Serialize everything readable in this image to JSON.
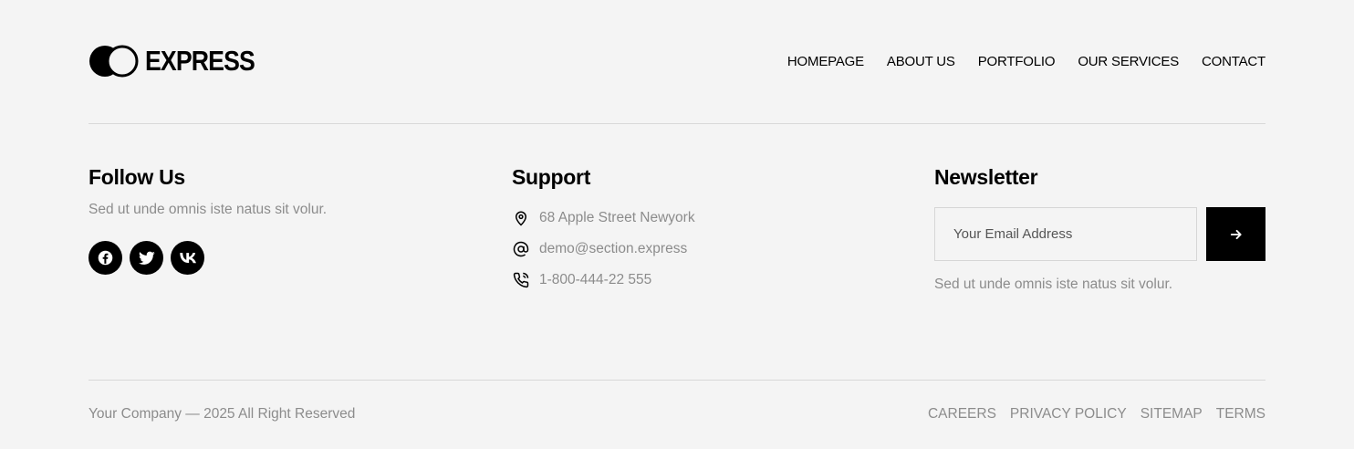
{
  "brand": {
    "name": "EXPRESS"
  },
  "nav": [
    {
      "label": "HOMEPAGE"
    },
    {
      "label": "ABOUT US"
    },
    {
      "label": "PORTFOLIO"
    },
    {
      "label": "OUR SERVICES"
    },
    {
      "label": "CONTACT"
    }
  ],
  "follow": {
    "title": "Follow Us",
    "description": "Sed ut unde omnis iste natus sit volur.",
    "social": [
      {
        "icon": "facebook-icon"
      },
      {
        "icon": "twitter-icon"
      },
      {
        "icon": "vk-icon"
      }
    ]
  },
  "support": {
    "title": "Support",
    "items": [
      {
        "icon": "location-pin-icon",
        "text": "68 Apple Street Newyork"
      },
      {
        "icon": "at-sign-icon",
        "text": "demo@section.express"
      },
      {
        "icon": "phone-icon",
        "text": "1-800-444-22 555"
      }
    ]
  },
  "newsletter": {
    "title": "Newsletter",
    "placeholder": "Your Email Address",
    "value": "",
    "submit_icon": "arrow-right-icon",
    "description": "Sed ut unde omnis iste natus sit volur."
  },
  "footer": {
    "copyright": "Your Company — 2025 All Right Reserved",
    "links": [
      {
        "label": "CAREERS"
      },
      {
        "label": "PRIVACY POLICY"
      },
      {
        "label": "SITEMAP"
      },
      {
        "label": "TERMS"
      }
    ]
  },
  "colors": {
    "background": "#f4f4f4",
    "accent": "#000000",
    "muted": "#8c8c8c",
    "divider": "#d8d8d8"
  }
}
